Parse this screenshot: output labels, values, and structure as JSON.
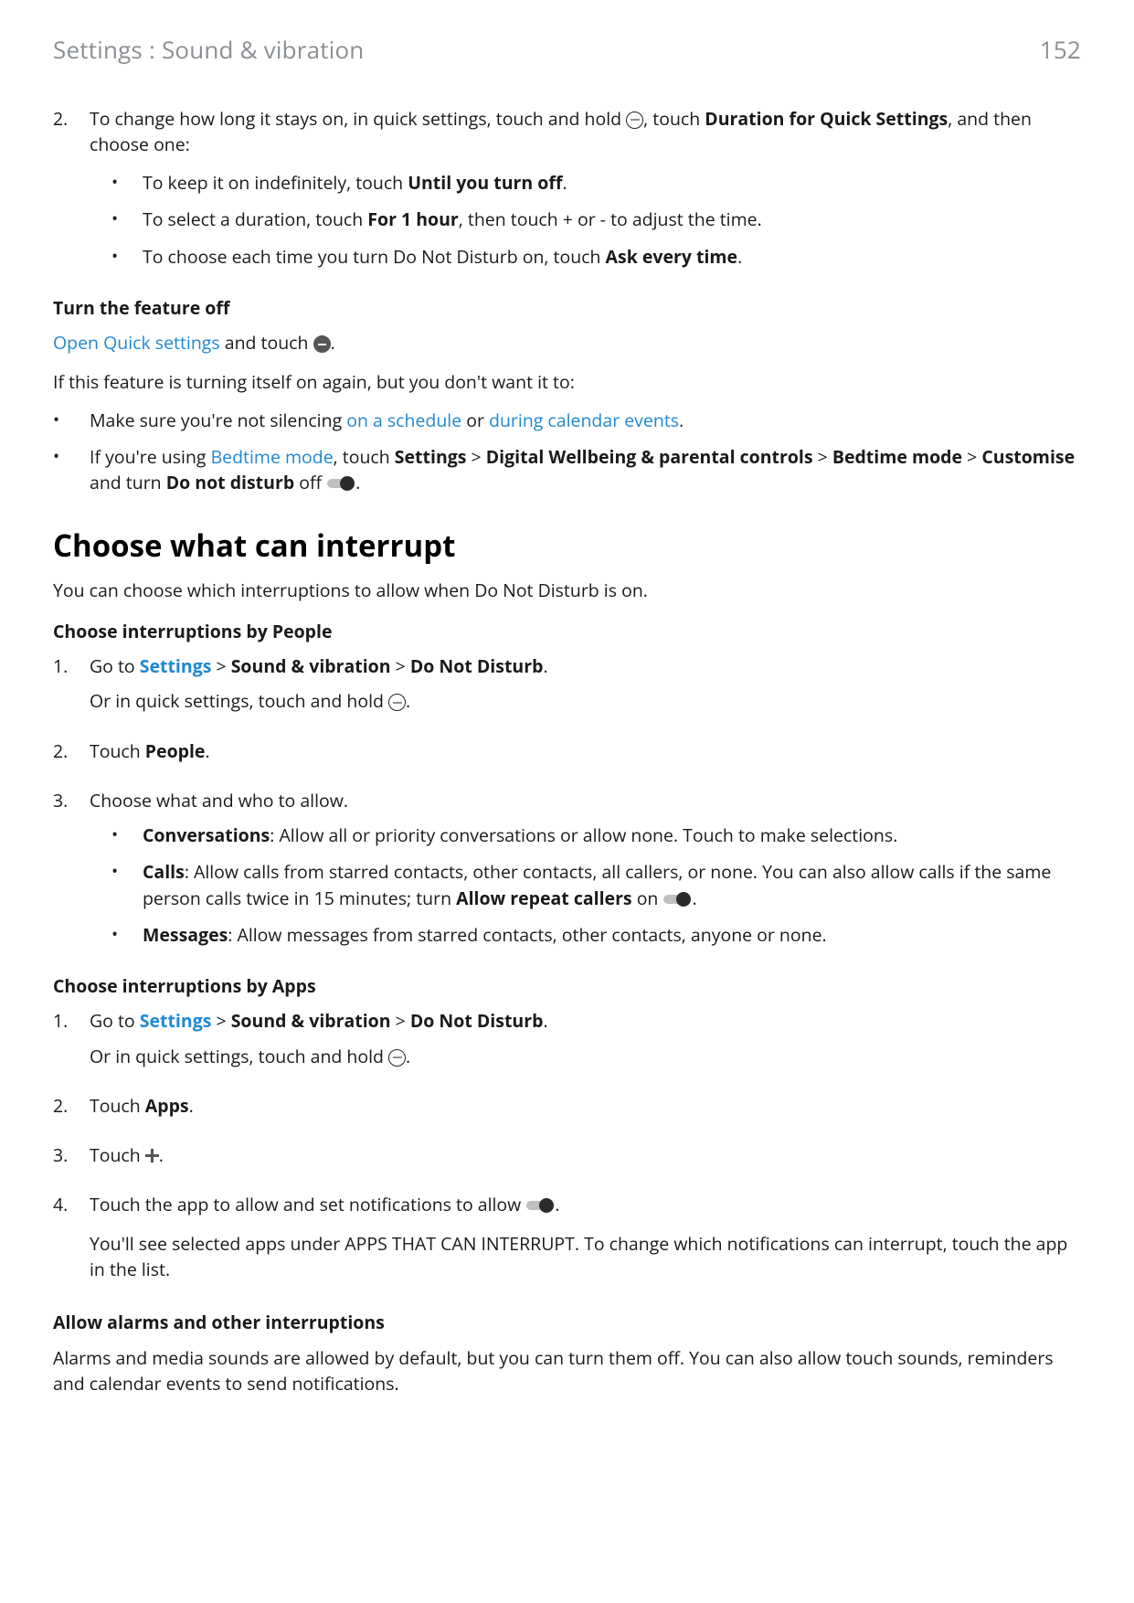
{
  "header": {
    "breadcrumb": "Settings : Sound & vibration",
    "page_number": "152"
  },
  "step2": {
    "num": "2.",
    "lead_a": "To change how long it stays on, in quick settings, touch and hold ",
    "lead_b": ", touch ",
    "bold_duration": "Duration for Quick Settings",
    "lead_c": ", and then choose one:",
    "b1_a": "To keep it on indefinitely, touch ",
    "b1_b": "Until you turn off",
    "b1_c": ".",
    "b2_a": "To select a duration, touch ",
    "b2_b": "For 1 hour",
    "b2_c": ", then touch + or - to adjust the time.",
    "b3_a": "To choose each time you turn Do Not Disturb on, touch ",
    "b3_b": "Ask every time",
    "b3_c": "."
  },
  "turn_off": {
    "heading": "Turn the feature off",
    "open_link": "Open Quick settings",
    "after_link_a": " and touch ",
    "after_link_b": ".",
    "line2": "If this feature is turning itself on again, but you don't want it to:",
    "bul1_a": "Make sure you're not silencing ",
    "bul1_link1": "on a schedule",
    "bul1_mid": " or ",
    "bul1_link2": "during calendar events",
    "bul1_end": ".",
    "bul2_a": "If you're using ",
    "bul2_link": "Bedtime mode",
    "bul2_b": ", touch ",
    "bul2_settings": "Settings",
    "bul2_gt": " > ",
    "bul2_dwpc": "Digital Wellbeing & parental controls",
    "bul2_bt": "Bedtime mode",
    "bul2_cust": "Customise",
    "bul2_c": " and turn ",
    "bul2_dnd": "Do not disturb",
    "bul2_off": " off ",
    "bul2_end": "."
  },
  "choose": {
    "h2": "Choose what can interrupt",
    "intro": "You can choose which interruptions to allow when Do Not Disturb is on.",
    "people_head": "Choose interruptions by People",
    "p1_num": "1.",
    "p1_a": "Go to ",
    "p1_settings": "Settings",
    "p1_gt": " > ",
    "p1_sv": "Sound & vibration",
    "p1_dnd": "Do Not Disturb",
    "p1_end": ".",
    "p1_sub_a": "Or in quick settings, touch and hold ",
    "p1_sub_b": ".",
    "p2_num": "2.",
    "p2_a": "Touch ",
    "p2_b": "People",
    "p2_c": ".",
    "p3_num": "3.",
    "p3_a": "Choose what and who to allow.",
    "p3_b1_bold": "Conversations",
    "p3_b1_rest": ": Allow all or priority conversations or allow none. Touch to make selections.",
    "p3_b2_bold": "Calls",
    "p3_b2_rest_a": ": Allow calls from starred contacts, other contacts, all callers, or none. You can also allow calls if the same person calls twice in 15 minutes; turn ",
    "p3_b2_bold2": "Allow repeat callers",
    "p3_b2_rest_b": " on ",
    "p3_b2_end": ".",
    "p3_b3_bold": "Messages",
    "p3_b3_rest": ": Allow messages from starred contacts, other contacts, anyone or none.",
    "apps_head": "Choose interruptions by Apps",
    "a1_num": "1.",
    "a1_a": "Go to ",
    "a1_settings": "Settings",
    "a1_sv": "Sound & vibration",
    "a1_dnd": "Do Not Disturb",
    "a1_end": ".",
    "a1_sub_a": "Or in quick settings, touch and hold ",
    "a1_sub_b": ".",
    "a2_num": "2.",
    "a2_a": "Touch ",
    "a2_b": "Apps",
    "a2_c": ".",
    "a3_num": "3.",
    "a3_a": "Touch ",
    "a3_b": ".",
    "a4_num": "4.",
    "a4_a": "Touch the app to allow and set notifications to allow ",
    "a4_b": ".",
    "a4_sub": "You'll see selected apps under APPS THAT CAN INTERRUPT. To change which notifications can interrupt, touch the app in the list.",
    "alarms_head": "Allow alarms and other interruptions",
    "alarms_body": "Alarms and media sounds are allowed by default, but you can turn them off. You can also allow touch sounds, reminders and calendar events to send notifications."
  }
}
